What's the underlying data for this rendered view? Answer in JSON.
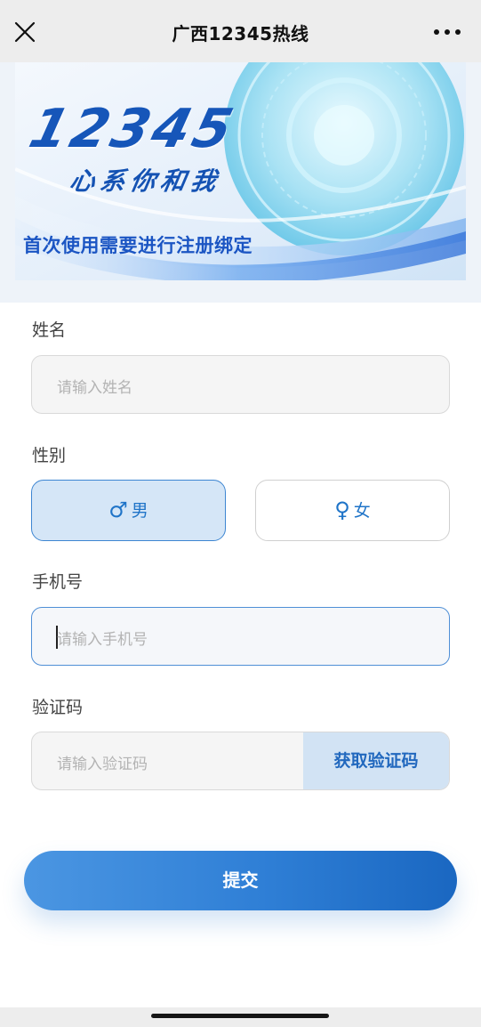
{
  "navbar": {
    "title": "广西12345热线",
    "close_icon": "close-icon",
    "more_icon": "more-dots-icon"
  },
  "banner": {
    "number": "12345",
    "slogan": "心系你和我",
    "notice": "首次使用需要进行注册绑定"
  },
  "form": {
    "name": {
      "label": "姓名",
      "placeholder": "请输入姓名"
    },
    "gender": {
      "label": "性别",
      "male": {
        "symbol": "♂",
        "label": "男",
        "selected": true
      },
      "female": {
        "symbol": "♀",
        "label": "女",
        "selected": false
      }
    },
    "phone": {
      "label": "手机号",
      "placeholder": "请输入手机号"
    },
    "code": {
      "label": "验证码",
      "placeholder": "请输入验证码",
      "button": "获取验证码"
    },
    "submit": "提交"
  },
  "colors": {
    "accent": "#2f7fd6",
    "selected_bg": "#d5e6f7",
    "banner_text": "#1656b9"
  }
}
